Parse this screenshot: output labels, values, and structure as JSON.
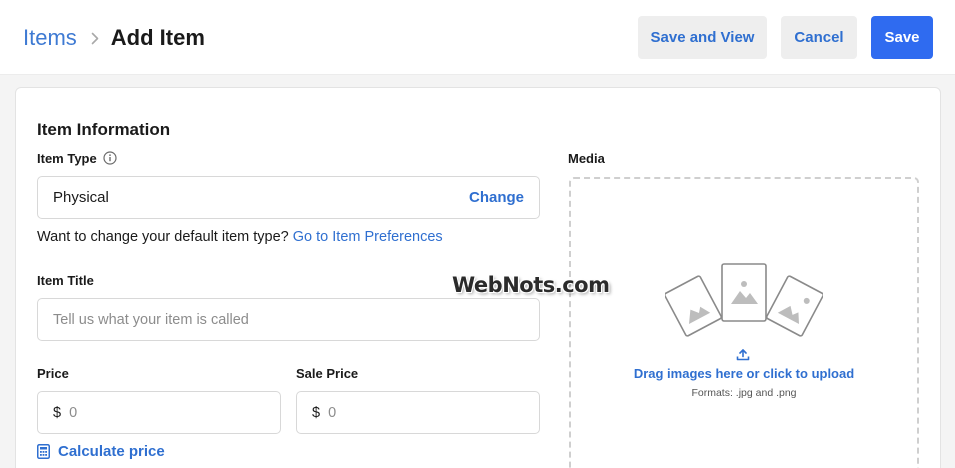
{
  "header": {
    "breadcrumb_parent": "Items",
    "page_title": "Add Item",
    "buttons": {
      "save_and_view": "Save and View",
      "cancel": "Cancel",
      "save": "Save"
    }
  },
  "form": {
    "section_title": "Item Information",
    "item_type": {
      "label": "Item Type",
      "value": "Physical",
      "change_label": "Change",
      "helper_text": "Want to change your default item type?",
      "helper_link": "Go to Item Preferences"
    },
    "item_title": {
      "label": "Item Title",
      "placeholder": "Tell us what your item is called"
    },
    "price": {
      "label": "Price",
      "currency": "$",
      "placeholder": "0"
    },
    "sale_price": {
      "label": "Sale Price",
      "currency": "$",
      "placeholder": "0"
    },
    "calculate_label": "Calculate price"
  },
  "media": {
    "label": "Media",
    "drop_text": "Drag images here or click to upload",
    "formats": "Formats: .jpg and .png"
  },
  "watermark": "WebNots.com",
  "colors": {
    "accent": "#2f6bf0",
    "link": "#2f6fd0",
    "breadcrumb_link": "#3e7ad3",
    "secondary_button_bg": "#eeeeee",
    "page_bg": "#f4f4f4"
  },
  "icons": {
    "breadcrumb_separator": "chevron-right-icon",
    "item_type_info": "info-icon",
    "calculate": "calculator-icon",
    "upload": "upload-icon",
    "media_placeholder": "image-placeholder-icon"
  }
}
